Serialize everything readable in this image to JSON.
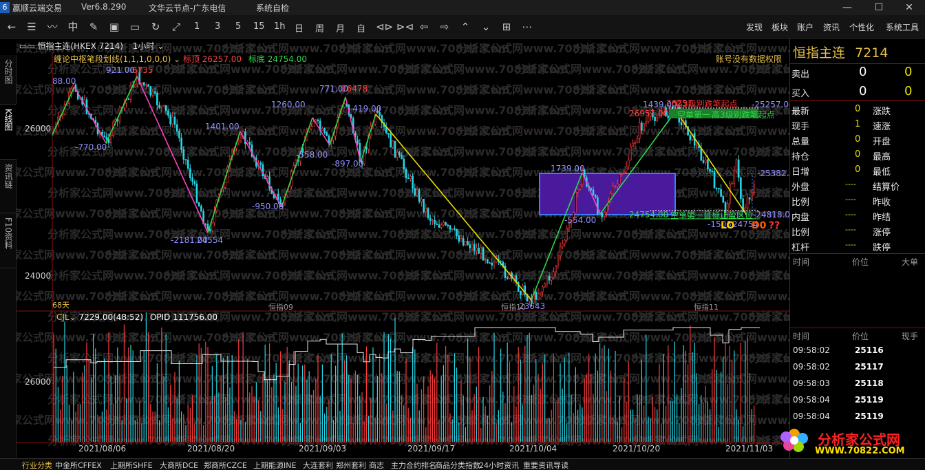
{
  "titlebar": {
    "app_name": "赢顺云端交易",
    "version": "Ver6.8.290",
    "server": "文华云节点-广东电信",
    "system_test": "系统自检",
    "min": "—",
    "max": "☐",
    "close": "✕"
  },
  "toolbar": {
    "periods": [
      "1",
      "3",
      "5",
      "15",
      "1h",
      "日",
      "周",
      "月",
      "自"
    ],
    "menus": [
      "发现",
      "板块",
      "账户",
      "资讯",
      "个性化",
      "系统工具"
    ]
  },
  "left_tabs": [
    "分时图",
    "K线图",
    "资讯链",
    "F10资料"
  ],
  "chart": {
    "symbol_label": "恒指主连(HKEX 7214)",
    "period_label": "1小时",
    "indicator_name": "缠论中枢笔段划线(1,1,1,0,0,0)",
    "top_label": "标顶",
    "top_value": "26257.00",
    "bottom_label": "标底",
    "bottom_value": "24754.00",
    "no_permission": "账号没有数据权限",
    "days_label": "68天",
    "y_labels": [
      "26000",
      "24000"
    ],
    "contract_labels": [
      "恒指09",
      "恒指10",
      "恒指11"
    ],
    "price_annotations": [
      {
        "text": "88.00",
        "color": "#8f8fff"
      },
      {
        "text": "921.00",
        "color": "#8f8fff"
      },
      {
        "text": "6735",
        "color": "#ff4040"
      },
      {
        "text": "-770.00",
        "color": "#8f8fff"
      },
      {
        "text": "-2181.00",
        "color": "#8f8fff"
      },
      {
        "text": "24554",
        "color": "#8f8fff"
      },
      {
        "text": "1401.00",
        "color": "#8f8fff"
      },
      {
        "text": "-950.00",
        "color": "#8f8fff"
      },
      {
        "text": "1260.00",
        "color": "#8f8fff"
      },
      {
        "text": "-558.00",
        "color": "#8f8fff"
      },
      {
        "text": "771.00",
        "color": "#8f8fff"
      },
      {
        "text": "26478",
        "color": "#ff4040"
      },
      {
        "text": "-897.00",
        "color": "#8f8fff"
      },
      {
        "text": "-419.00",
        "color": "#8f8fff"
      },
      {
        "text": "1739.00",
        "color": "#8f8fff"
      },
      {
        "text": "-554.00",
        "color": "#8f8fff"
      },
      {
        "text": "1439.00",
        "color": "#8f8fff"
      },
      {
        "text": "26257",
        "color": "#ff4040"
      },
      {
        "text": "26957.00",
        "color": "#ff4040"
      },
      {
        "text": "-25257.00",
        "color": "#8f8fff"
      },
      {
        "text": "-25382.00",
        "color": "#8f8fff"
      },
      {
        "text": "24754.00",
        "color": "#2fd84a"
      },
      {
        "text": "-24818.00",
        "color": "#8f8fff"
      },
      {
        "text": "-1503",
        "color": "#8f8fff"
      },
      {
        "text": "24754",
        "color": "#8f8fff"
      },
      {
        "text": "23643",
        "color": "#8f8fff"
      }
    ],
    "signal_top1": "高3级别跌笔起点",
    "signal_top2": "高3级别跌笔起点",
    "signal_top3": "空单第一",
    "signal_target": "空单第一目标止盈区位",
    "signal_lo": "LO",
    "signal_d0": "D0",
    "signal_q": "??"
  },
  "volume": {
    "label": "CJL",
    "value": "7229.00(48:52)",
    "opid_label": "OPID",
    "opid_value": "111756.00",
    "y_label": "26000"
  },
  "dates": [
    "2021/08/06",
    "2021/08/20",
    "2021/09/03",
    "2021/09/17",
    "2021/10/04",
    "2021/10/20",
    "2021/11/03"
  ],
  "watermark": "分析家公式网www.70822.Com",
  "right_panel": {
    "symbol": "恒指主连",
    "code": "7214",
    "sell_label": "卖出",
    "sell_price": "0",
    "sell_vol": "0",
    "buy_label": "买入",
    "buy_price": "0",
    "buy_vol": "0",
    "quote_left": [
      {
        "label": "最新",
        "value": "0"
      },
      {
        "label": "现手",
        "value": "1"
      },
      {
        "label": "总量",
        "value": "0"
      },
      {
        "label": "持仓",
        "value": "0"
      },
      {
        "label": "日增",
        "value": "0"
      },
      {
        "label": "外盘",
        "value": "----"
      },
      {
        "label": "比例",
        "value": "----"
      },
      {
        "label": "内盘",
        "value": "----"
      },
      {
        "label": "比例",
        "value": "----"
      },
      {
        "label": "杠杆",
        "value": "----"
      }
    ],
    "quote_right": [
      "涨跌",
      "速涨",
      "开盘",
      "最高",
      "最低",
      "结算价",
      "昨收",
      "昨结",
      "涨停",
      "跌停"
    ],
    "hdr1": [
      "时间",
      "价位",
      "大单"
    ],
    "hdr2": [
      "时间",
      "价位",
      "现手"
    ],
    "ticks": [
      {
        "time": "09:58:02",
        "price": "25116"
      },
      {
        "time": "09:58:02",
        "price": "25117"
      },
      {
        "time": "09:58:03",
        "price": "25118"
      },
      {
        "time": "09:58:04",
        "price": "25119"
      },
      {
        "time": "09:58:04",
        "price": "25119"
      }
    ]
  },
  "bottom_tabs": [
    "行业分类",
    "中金所CFFEX",
    "上期所SHFE",
    "大商所DCE",
    "郑商所CZCE",
    "上期能源INE",
    "大连套利",
    "郑州套利",
    "商志",
    "主力合约排名",
    "商品分类指数",
    "24小时资讯",
    "重要资讯导读"
  ],
  "logo": {
    "title": "分析家公式网",
    "url": "WWW.70822.COM"
  }
}
